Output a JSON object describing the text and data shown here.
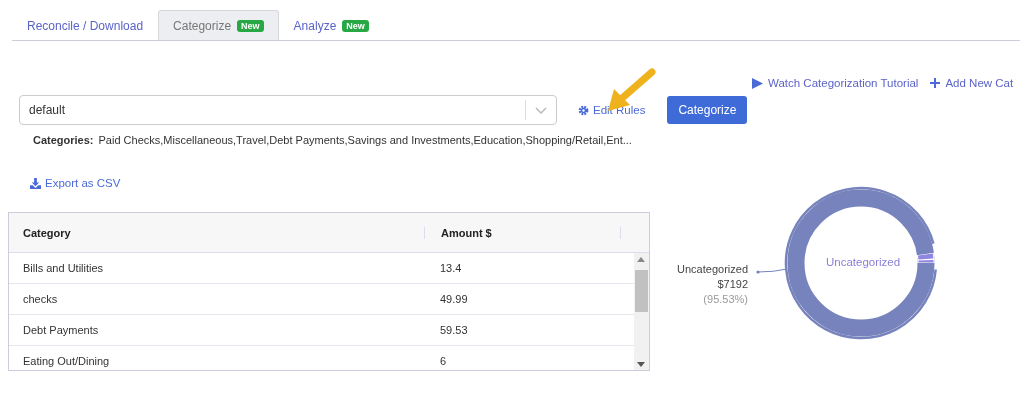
{
  "tabs": [
    {
      "label": "Reconcile / Download",
      "selected": false
    },
    {
      "label": "Categorize",
      "selected": true,
      "badge": "New"
    },
    {
      "label": "Analyze",
      "selected": false,
      "badge": "New"
    }
  ],
  "links": [
    {
      "kind": "play",
      "label": "Watch Categorization Tutorial"
    },
    {
      "kind": "plus",
      "label": "Add New Cat"
    }
  ],
  "rule_select": {
    "value": "default"
  },
  "edit_rules": "Edit Rules",
  "categorize_button": "Categorize",
  "categories": {
    "label": "Categories:",
    "value": "Paid Checks,Miscellaneous,Travel,Debt Payments,Savings and Investments,Education,Shopping/Retail,Ent..."
  },
  "export": "Export as CSV",
  "table": {
    "columns": [
      "Category",
      "Amount $"
    ],
    "rows": [
      [
        "Bills and Utilities",
        "13.4"
      ],
      [
        "checks",
        "49.99"
      ],
      [
        "Debt Payments",
        "59.53"
      ],
      [
        "Eating Out/Dining",
        "6"
      ]
    ]
  },
  "donut": {
    "center_label": "Uncategorized",
    "callout": {
      "name": "Uncategorized",
      "amount": "$7192",
      "percent": "(95.53%)"
    }
  }
}
